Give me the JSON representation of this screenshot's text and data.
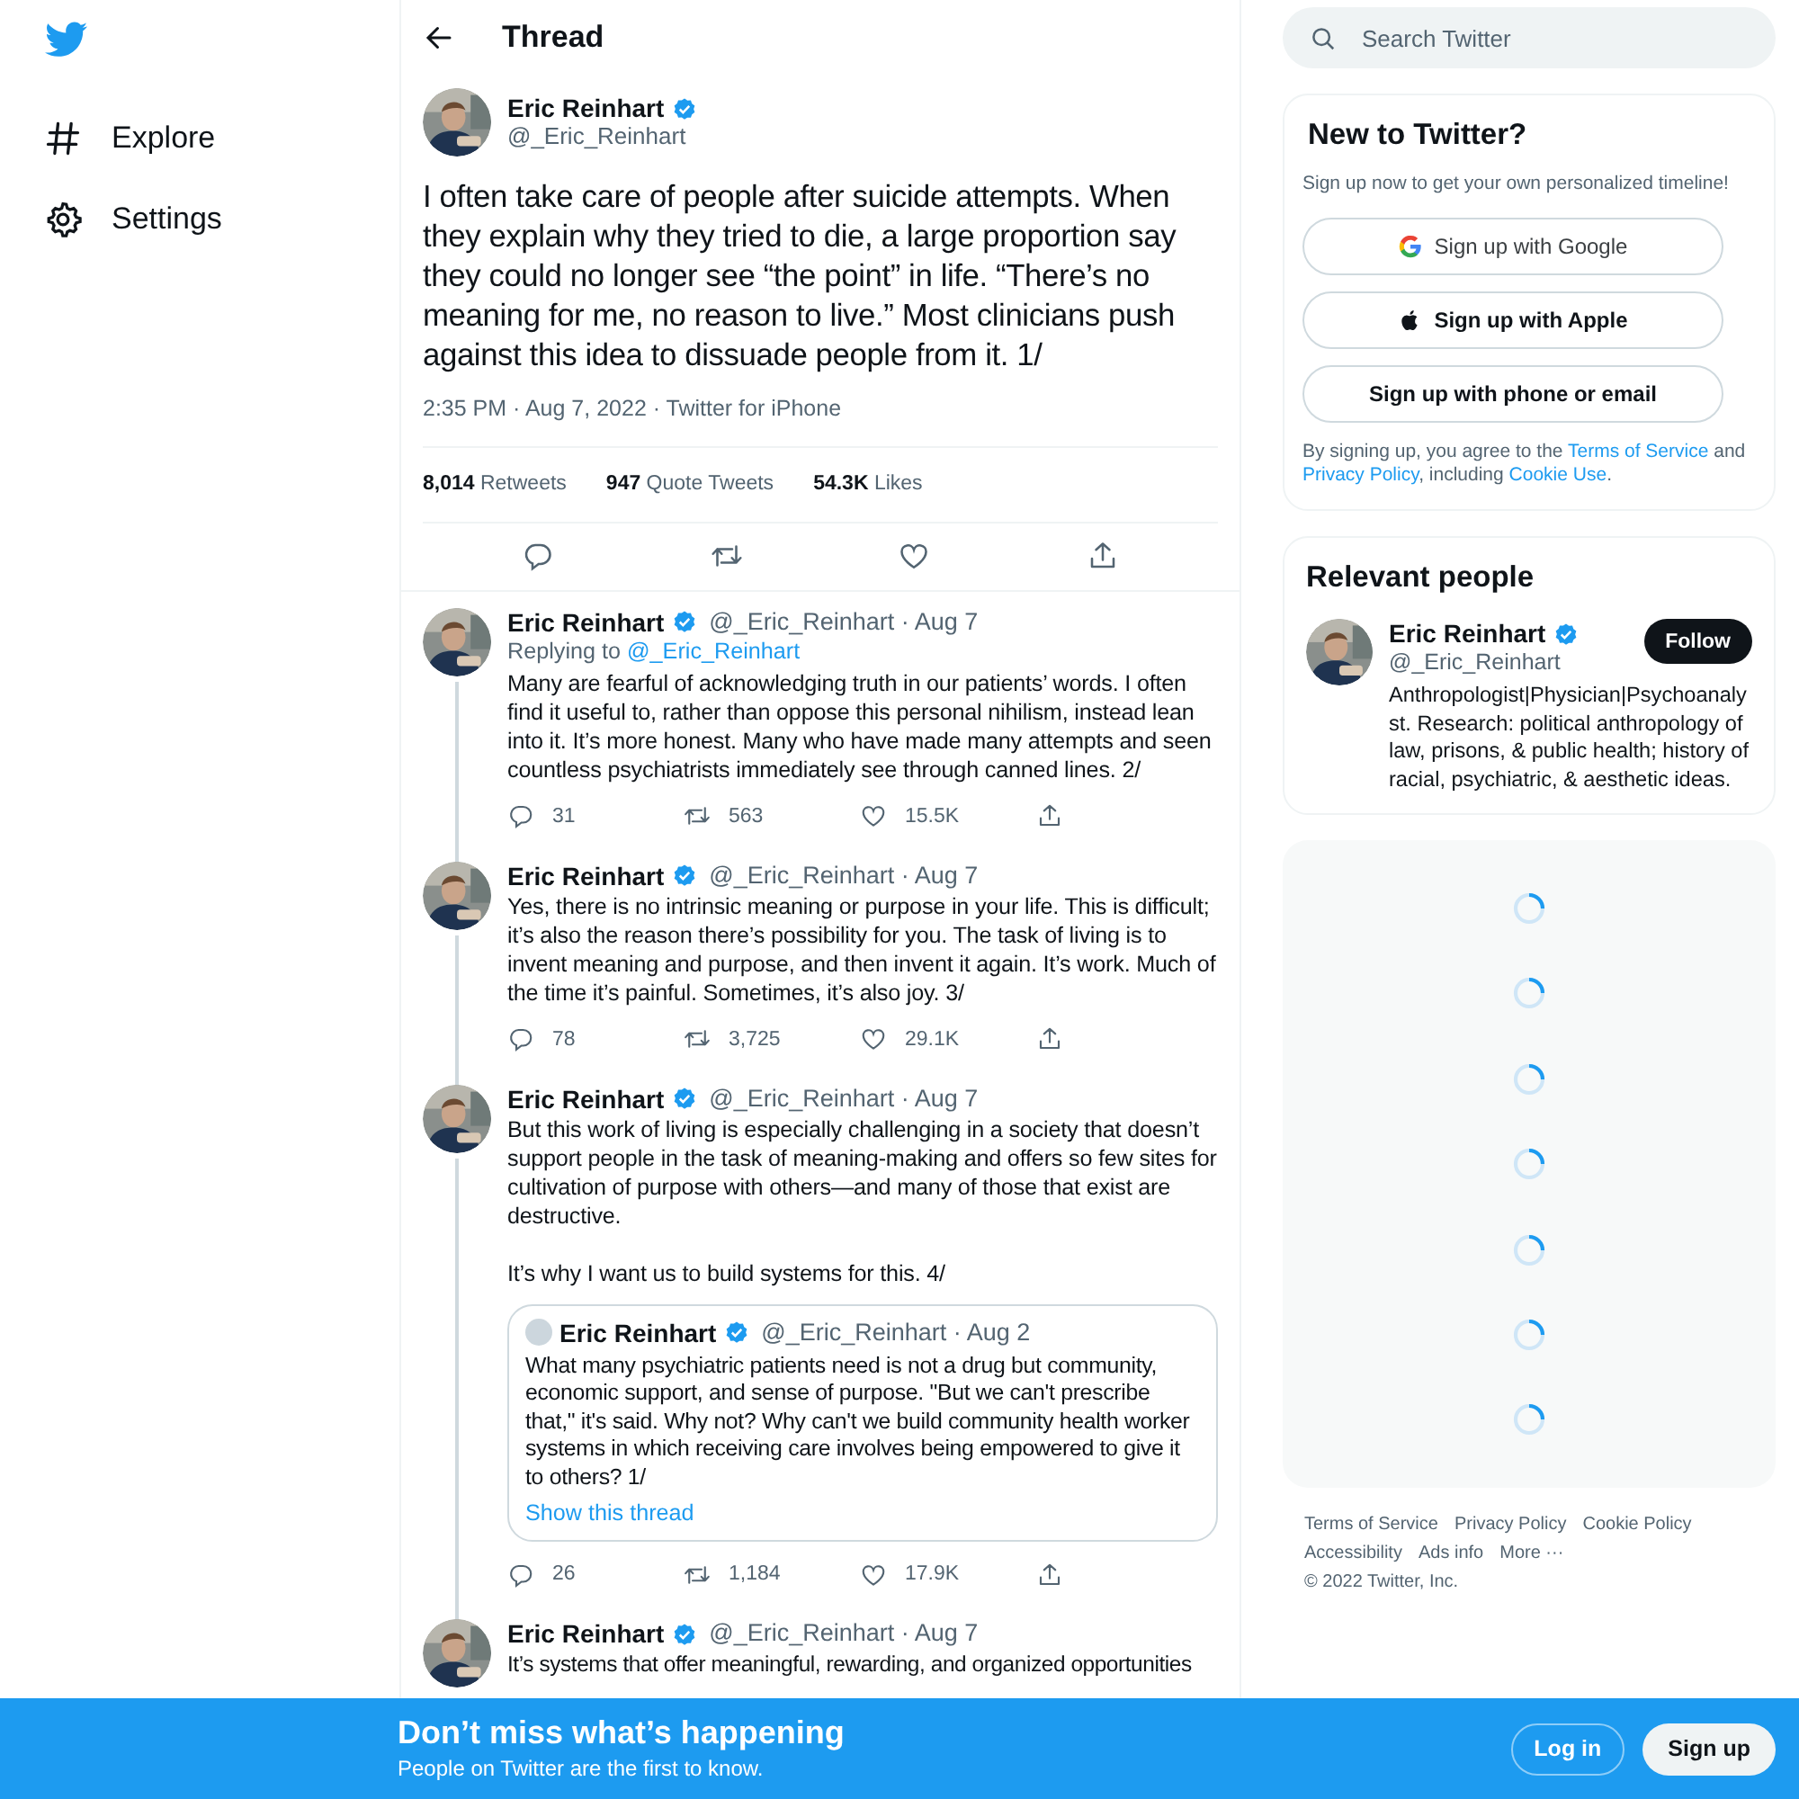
{
  "nav": [
    {
      "kind": "hashtag",
      "label": "Explore"
    },
    {
      "kind": "gear",
      "label": "Settings"
    }
  ],
  "header": {
    "title": "Thread"
  },
  "main_tweet": {
    "name": "Eric Reinhart",
    "verified": true,
    "handle": "@_Eric_Reinhart",
    "text": "I often take care of people after suicide attempts. When they explain why they tried to die, a large proportion say they could no longer see “the point” in life. “There’s no meaning for me, no reason to live.” Most clinicians push against this idea to dissuade people from it. 1/",
    "meta": "2:35 PM · Aug 7, 2022 · Twitter for iPhone",
    "stats": [
      "**8,014** Retweets",
      "**947** Quote Tweets",
      "**54.3K** Likes"
    ]
  },
  "replies": [
    {
      "name": "Eric Reinhart",
      "verified": true,
      "byline": "@_Eric_Reinhart · Aug 7",
      "replying_to": {
        "prefix": "Replying to",
        "handle": "@_Eric_Reinhart"
      },
      "paragraphs": [
        "Many are fearful of acknowledging truth in our patients’ words. I often find it useful to, rather than oppose this personal nihilism, instead lean into it. It’s more honest. Many who have made many attempts and seen countless psychiatrists immediately see through canned lines. 2/"
      ],
      "counts": {
        "replies": "31",
        "retweets": "563",
        "likes": "15.5K"
      }
    },
    {
      "name": "Eric Reinhart",
      "verified": true,
      "byline": "@_Eric_Reinhart · Aug 7",
      "paragraphs": [
        "Yes, there is no intrinsic meaning or purpose in your life. This is difficult; it’s also the reason there’s possibility for you. The task of living is to invent meaning and purpose, and then invent it again. It’s work. Much of the time it’s painful. Sometimes, it’s also joy. 3/"
      ],
      "counts": {
        "replies": "78",
        "retweets": "3,725",
        "likes": "29.1K"
      }
    },
    {
      "name": "Eric Reinhart",
      "verified": true,
      "byline": "@_Eric_Reinhart · Aug 7",
      "paragraphs": [
        "But this work of living is especially challenging in a society that doesn’t support people in the task of meaning-making and offers so few sites for cultivation of purpose with others—and many of those that exist are destructive.",
        "It’s why I want us to build systems for this. 4/"
      ],
      "quote": {
        "name": "Eric Reinhart",
        "verified": true,
        "byline": "@_Eric_Reinhart · Aug 2",
        "text": "What many psychiatric patients need is not a drug but community, economic support, and sense of purpose. \"But we can't prescribe that,\" it's said. Why not? Why can't we build community health worker systems in which receiving care involves being empowered to give it to others? 1/",
        "link": "Show this thread"
      },
      "counts": {
        "replies": "26",
        "retweets": "1,184",
        "likes": "17.9K"
      }
    },
    {
      "name": "Eric Reinhart",
      "verified": true,
      "byline": "@_Eric_Reinhart · Aug 7",
      "paragraphs": [
        "It’s systems that offer meaningful, rewarding, and organized opportunities"
      ]
    }
  ],
  "search": {
    "placeholder": "Search Twitter"
  },
  "signup_card": {
    "title": "New to Twitter?",
    "subtitle": "Sign up now to get your own personalized timeline!",
    "buttons": [
      {
        "kind": "google",
        "label": "Sign up with Google"
      },
      {
        "kind": "apple",
        "label": "Sign up with Apple"
      },
      {
        "kind": "plain",
        "label": "Sign up with phone or email"
      }
    ],
    "legal": [
      {
        "kind": "text",
        "text": "By signing up, you agree to the"
      },
      {
        "kind": "link",
        "text": "Terms of Service"
      },
      {
        "kind": "text",
        "text": "and"
      },
      {
        "kind": "link",
        "text": "Privacy Policy"
      },
      {
        "kind": "text",
        "text": ", including"
      },
      {
        "kind": "link",
        "text": "Cookie Use"
      },
      {
        "kind": "text",
        "text": "."
      }
    ]
  },
  "relevant_people": {
    "title": "Relevant people",
    "people": [
      {
        "name": "Eric Reinhart",
        "verified": true,
        "handle": "@_Eric_Reinhart",
        "button": "Follow",
        "bio": "Anthropologist|Physician|Psychoanalyst. Research: political anthropology of law, prisons, & public health; history of racial, psychiatric, & aesthetic ideas."
      }
    ]
  },
  "footer": {
    "links": [
      "Terms of Service",
      "Privacy Policy",
      "Cookie Policy",
      "Accessibility",
      "Ads info",
      "More ···"
    ],
    "copyright": "© 2022 Twitter, Inc."
  },
  "banner": {
    "title": "Don’t miss what’s happening",
    "subtitle": "People on Twitter are the first to know.",
    "buttons": [
      {
        "kind": "outline",
        "label": "Log in"
      },
      {
        "kind": "filled",
        "label": "Sign up"
      }
    ]
  }
}
